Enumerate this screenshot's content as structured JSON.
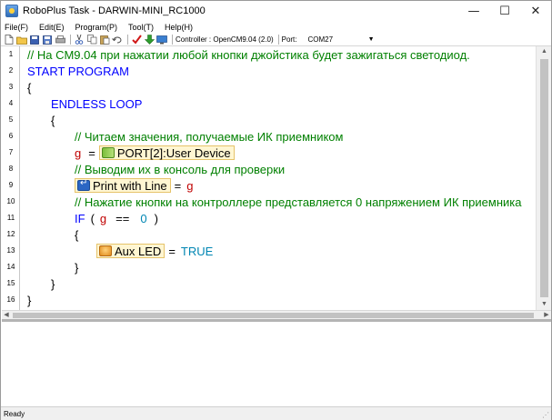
{
  "window": {
    "title": "RoboPlus Task - DARWIN-MINI_RC1000",
    "minimize_glyph": "—",
    "maximize_glyph": "☐",
    "close_glyph": "✕"
  },
  "menu": [
    {
      "label": "File(F)"
    },
    {
      "label": "Edit(E)"
    },
    {
      "label": "Program(P)"
    },
    {
      "label": "Tool(T)"
    },
    {
      "label": "Help(H)"
    }
  ],
  "toolbar": {
    "controller_label": "Controller : OpenCM9.04 (2.0)",
    "port_label": "Port:",
    "port_value": "COM27",
    "icons": [
      "new-file-icon",
      "open-folder-icon",
      "save-icon",
      "save-as-icon",
      "print-icon",
      "cut-icon",
      "copy-icon",
      "paste-icon",
      "undo-icon",
      "compile-check-icon",
      "download-icon",
      "monitor-icon"
    ],
    "colors": {
      "check": "#d01818",
      "download": "#2e9d2e"
    }
  },
  "editor": {
    "line_numbers": [
      "1",
      "2",
      "3",
      "4",
      "5",
      "6",
      "7",
      "8",
      "9",
      "10",
      "11",
      "12",
      "13",
      "14",
      "15",
      "16"
    ],
    "lines": {
      "l1_comment": "// На CM9.04 при нажатии любой кнопки джойстика будет зажигаться светодиод.",
      "l2_keyword": "START PROGRAM",
      "l3_brace": "{",
      "l4_keyword": "ENDLESS LOOP",
      "l5_brace": "{",
      "l6_comment": "// Читаем значения, получаемые ИК приемником",
      "l7_var": "g",
      "l7_op": "=",
      "l7_block": "PORT[2]:User Device",
      "l8_comment": "// Выводим их в консоль для проверки",
      "l9_block": "Print with Line",
      "l9_op": "=",
      "l9_var": "g",
      "l10_comment": "// Нажатие кнопки на контроллере представляется 0 напряжением ИК приемника",
      "l11_kw": "IF",
      "l11_open": "(",
      "l11_var": "g",
      "l11_op": "==",
      "l11_num": "0",
      "l11_close": ")",
      "l12_brace": "{",
      "l13_block": "Aux LED",
      "l13_op": "=",
      "l13_const": "TRUE",
      "l14_brace": "}",
      "l15_brace": "}",
      "l16_brace": "}"
    },
    "scroll_up_glyph": "▲",
    "scroll_down_glyph": "▼",
    "scroll_left_glyph": "◀",
    "scroll_right_glyph": "▶"
  },
  "status": {
    "text": "Ready"
  },
  "colors": {
    "comment": "#008000",
    "keyword": "#0000ff",
    "variable": "#c00000",
    "constant": "#0086b3",
    "block_bg": "#fff6d2"
  }
}
